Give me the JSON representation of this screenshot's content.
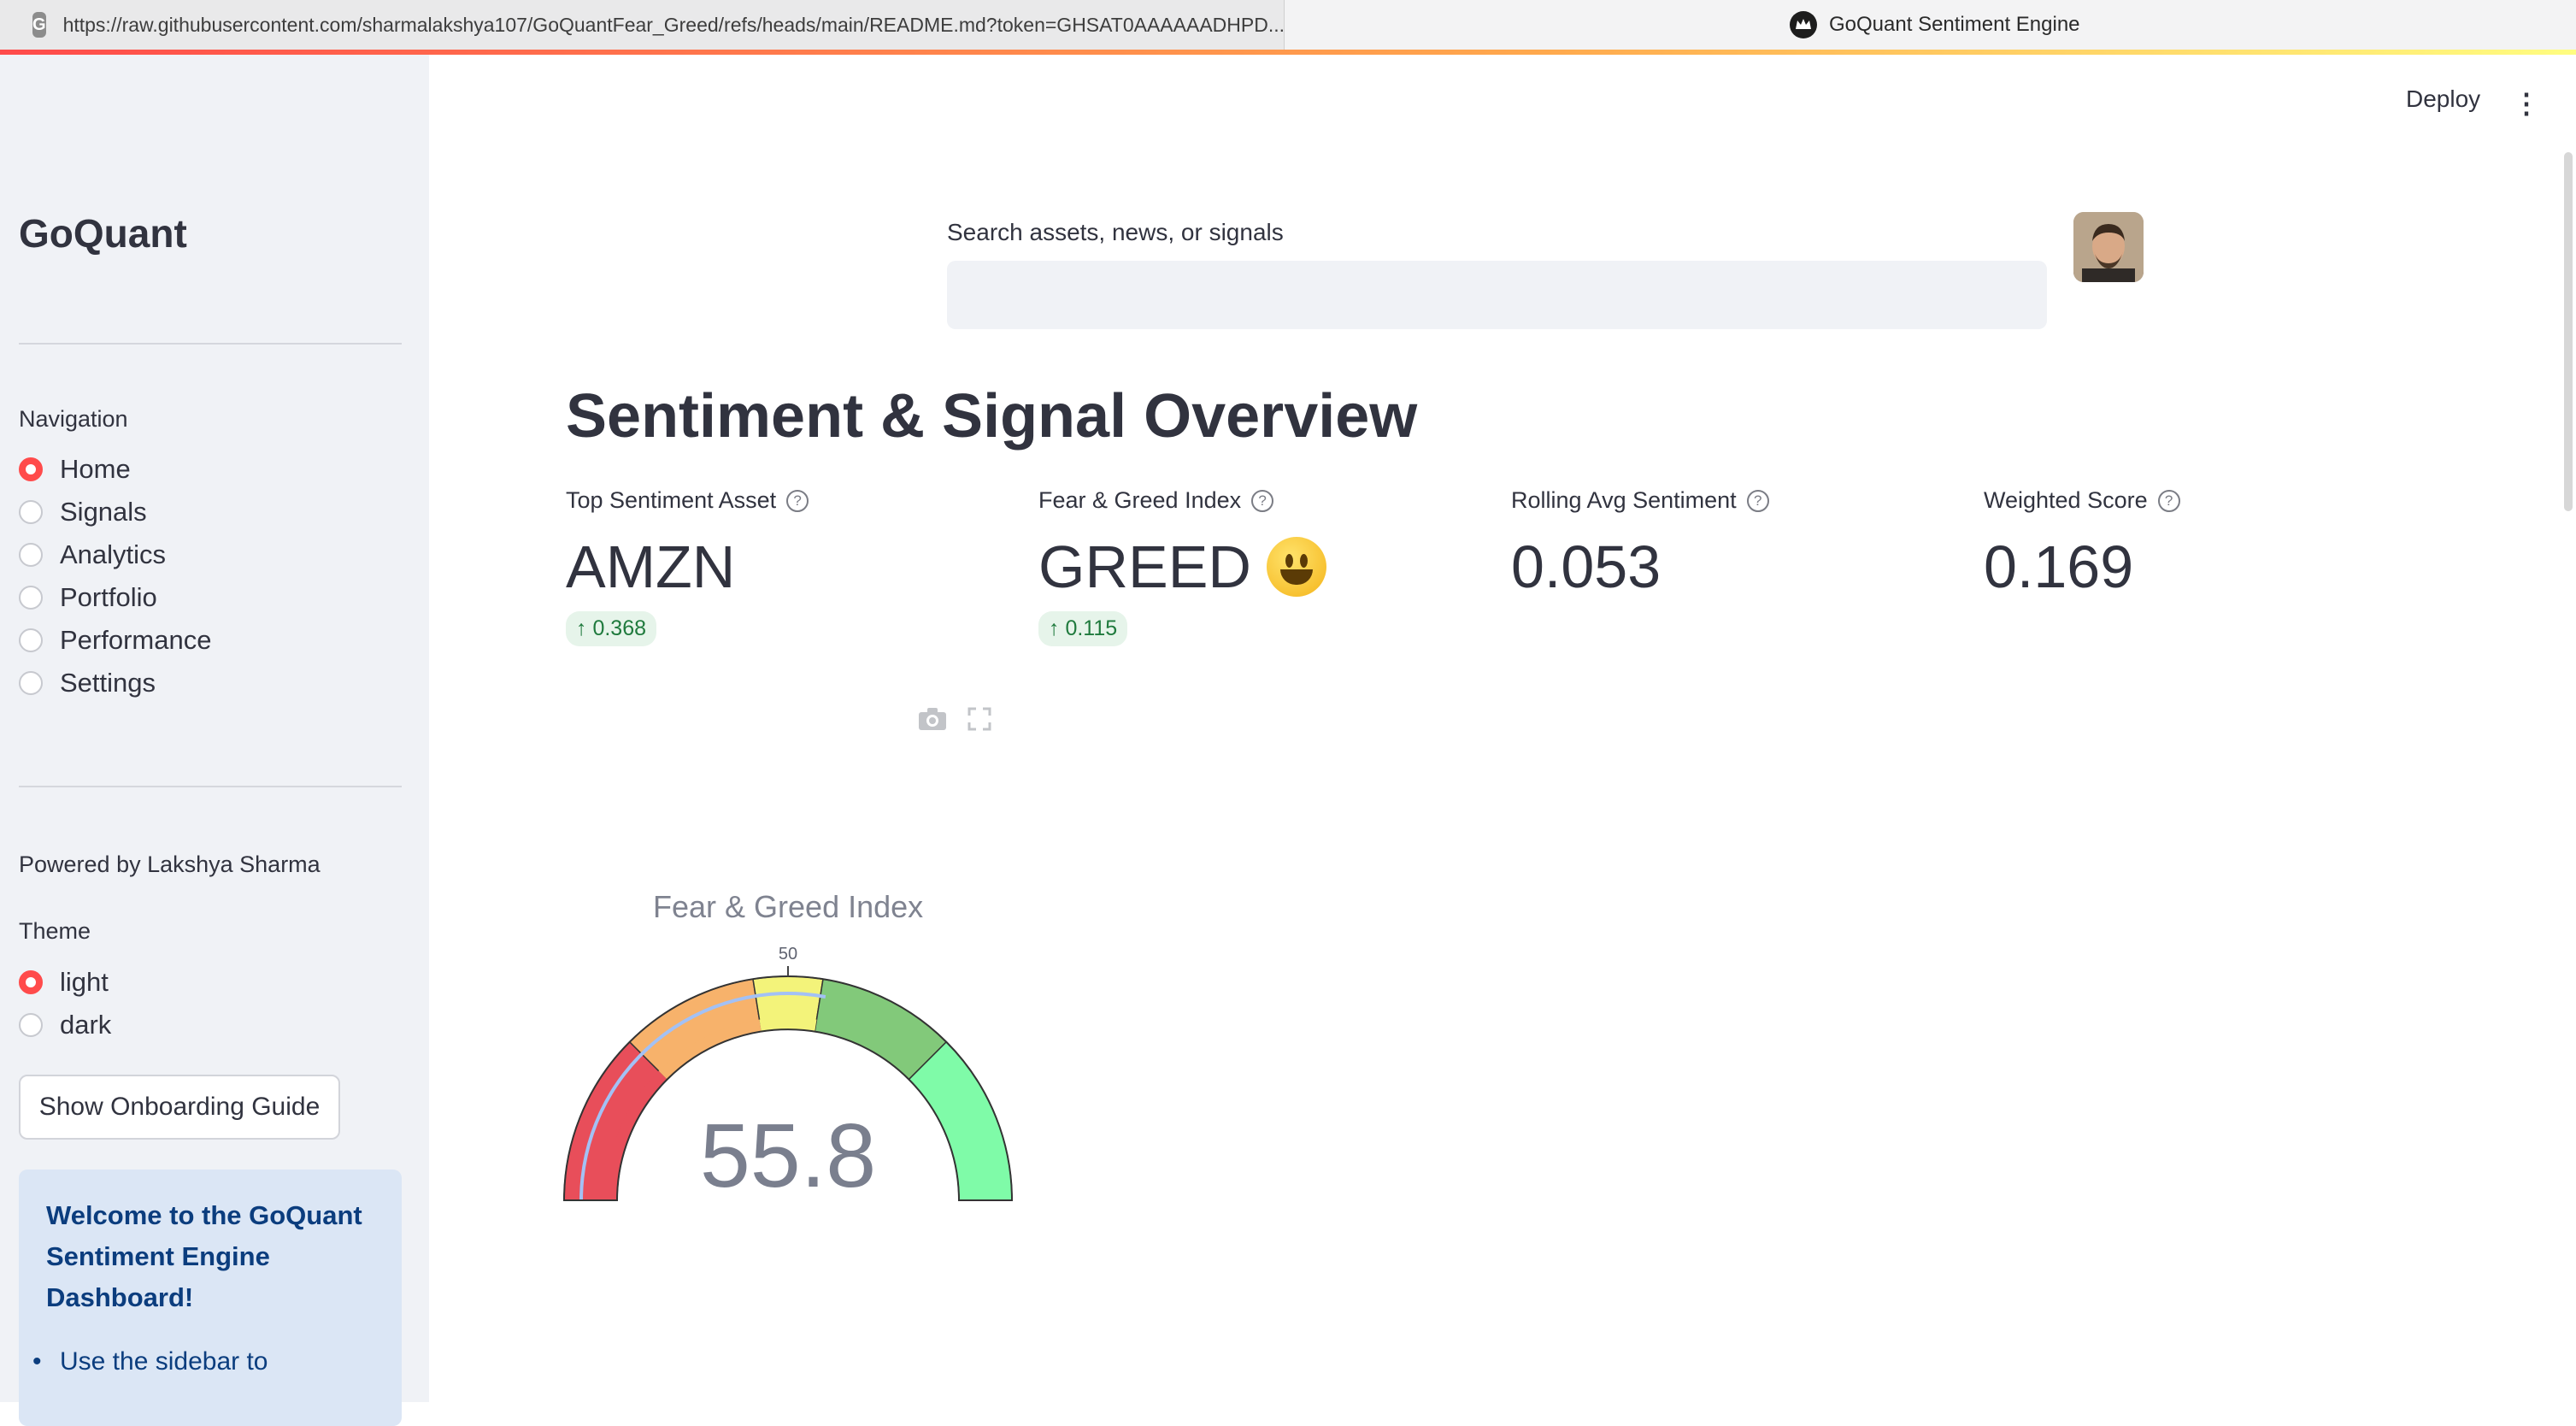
{
  "browser": {
    "tab_url": "https://raw.githubusercontent.com/sharmalakshya107/GoQuantFear_Greed/refs/heads/main/README.md?token=GHSAT0AAAAAADHPD...",
    "tab_favicon_letter": "G",
    "page_tab_title": "GoQuant Sentiment Engine"
  },
  "header": {
    "deploy_label": "Deploy",
    "menu_icon": "kebab-icon"
  },
  "sidebar": {
    "brand": "GoQuant",
    "nav_label": "Navigation",
    "nav_items": [
      {
        "label": "Home",
        "selected": true
      },
      {
        "label": "Signals",
        "selected": false
      },
      {
        "label": "Analytics",
        "selected": false
      },
      {
        "label": "Portfolio",
        "selected": false
      },
      {
        "label": "Performance",
        "selected": false
      },
      {
        "label": "Settings",
        "selected": false
      }
    ],
    "powered_by": "Powered by Lakshya Sharma",
    "theme_label": "Theme",
    "theme_options": [
      {
        "label": "light",
        "selected": true
      },
      {
        "label": "dark",
        "selected": false
      }
    ],
    "onboarding_button": "Show Onboarding Guide",
    "welcome_heading": "Welcome to the GoQuant Sentiment Engine Dashboard!",
    "welcome_bullet": "Use the sidebar to"
  },
  "main": {
    "search_label": "Search assets, news, or signals",
    "search_value": "",
    "title": "Sentiment & Signal Overview",
    "metrics": [
      {
        "label": "Top Sentiment Asset",
        "value": "AMZN",
        "delta": "↑ 0.368"
      },
      {
        "label": "Fear & Greed Index",
        "value": "GREED",
        "delta": "↑ 0.115"
      },
      {
        "label": "Rolling Avg Sentiment",
        "value": "0.053",
        "delta": ""
      },
      {
        "label": "Weighted Score",
        "value": "0.169",
        "delta": ""
      }
    ],
    "help_glyph": "?",
    "toolbar_icons": [
      "camera-icon",
      "fullscreen-icon"
    ]
  },
  "chart_data": {
    "type": "gauge",
    "title": "Fear & Greed Index",
    "value": 55.8,
    "range": [
      0,
      100
    ],
    "tick_label": "50",
    "steps": [
      {
        "range": [
          0,
          25
        ],
        "color": "#e84e5a"
      },
      {
        "range": [
          25,
          45
        ],
        "color": "#f7b26b"
      },
      {
        "range": [
          45,
          55
        ],
        "color": "#f3f37a"
      },
      {
        "range": [
          55,
          75
        ],
        "color": "#82c97a"
      },
      {
        "range": [
          75,
          100
        ],
        "color": "#7ffba8"
      }
    ],
    "bar_color": "#a3c1f5",
    "inner_steps": [
      {
        "range": [
          0,
          25
        ],
        "color": "#e84e5a"
      },
      {
        "range": [
          25,
          45
        ],
        "color": "#f7b26b"
      },
      {
        "range": [
          45,
          55
        ],
        "color": "#f3f37a"
      }
    ]
  },
  "colors": {
    "accent": "#ff4b4b",
    "sidebar_bg": "#f0f2f6",
    "info_bg": "#dbe6f5",
    "delta_green": "#1f7a3d"
  }
}
